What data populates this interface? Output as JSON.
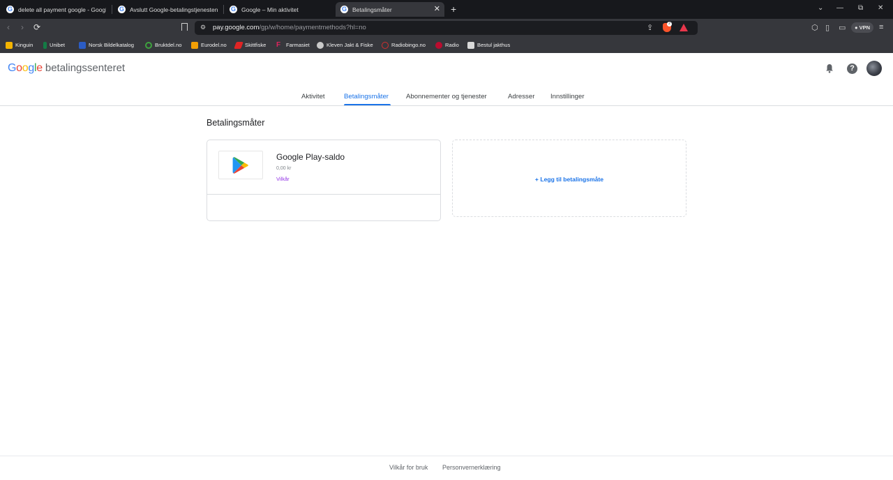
{
  "browser": {
    "tabs": [
      {
        "label": "delete all payment google - Google"
      },
      {
        "label": "Avslutt Google-betalingstjenesten fo"
      },
      {
        "label": "Google – Min aktivitet"
      },
      {
        "label": "Betalingsmåter",
        "active": true
      }
    ],
    "new_tab": "+",
    "url_domain": "pay.google.com",
    "url_path": "/gp/w/home/paymentmethods?hl=no",
    "vpn_label": "VPN",
    "brave_badge": "2",
    "bookmarks": [
      {
        "label": "Kinguin",
        "icon": "crown-icon",
        "color": "#f4b400"
      },
      {
        "label": "Unibet",
        "icon": "unibet-icon",
        "color": "#147b45"
      },
      {
        "label": "Norsk Bildelkatalog",
        "icon": "bildel-icon",
        "color": "#2b5cc4"
      },
      {
        "label": "Bruktdel.no",
        "icon": "bruktdel-icon",
        "color": "#3ea33e"
      },
      {
        "label": "Eurodel.no",
        "icon": "eurodel-icon",
        "color": "#f29f05"
      },
      {
        "label": "Skittfiske",
        "icon": "skittfiske-icon",
        "color": "#e02424"
      },
      {
        "label": "Farmasiet",
        "icon": "farmasiet-icon",
        "color": "#e0245e"
      },
      {
        "label": "Kleven Jakt & Fiske",
        "icon": "globe-icon",
        "color": "#c9c9c9"
      },
      {
        "label": "Radiobingo.no",
        "icon": "radiobingo-icon",
        "color": "#d32f2f"
      },
      {
        "label": "Radio",
        "icon": "norway-flag-icon",
        "color": "#ba0c2f"
      },
      {
        "label": "Bestul jakthus",
        "icon": "bestul-icon",
        "color": "#d9d9d9"
      }
    ]
  },
  "header": {
    "logo": "Google",
    "product": "betalingssenteret",
    "colors": {
      "blue": "#4285f4",
      "red": "#ea4335",
      "yellow": "#fbbc05",
      "green": "#34a853"
    }
  },
  "nav": {
    "tabs": [
      {
        "label": "Aktivitet"
      },
      {
        "label": "Betalingsmåter",
        "active": true
      },
      {
        "label": "Abonnementer og tjenester"
      },
      {
        "label": "Adresser"
      },
      {
        "label": "Innstillinger"
      }
    ]
  },
  "main": {
    "title": "Betalingsmåter",
    "payment_card": {
      "name": "Google Play-saldo",
      "balance": "0,00 kr",
      "terms_link": "Vilkår",
      "icon": "google-play-icon"
    },
    "add_method": "+ Legg til betalingsmåte"
  },
  "footer": {
    "terms": "Vilkår for bruk",
    "privacy": "Personvernerklæring"
  },
  "accent_color": "#1a73e8"
}
